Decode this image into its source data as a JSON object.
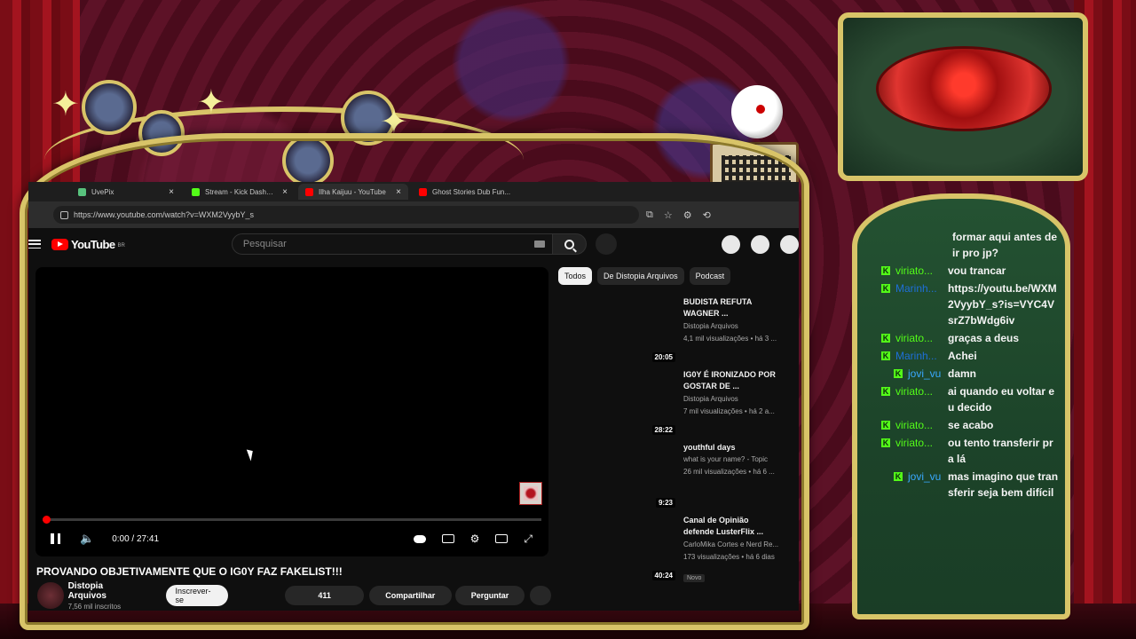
{
  "browser": {
    "tabs": [
      {
        "label": "UvePix",
        "color": "#58c27d",
        "active": false
      },
      {
        "label": "Stream - Kick Dashboard",
        "color": "#53fc18",
        "active": false
      },
      {
        "label": "Ilha Kaijuu - YouTube",
        "color": "#ff0000",
        "active": true
      },
      {
        "label": "Ghost Stories Dub Fun...",
        "color": "#ff0000",
        "active": false
      }
    ],
    "url": "https://www.youtube.com/watch?v=WXM2VyybY_s"
  },
  "youtube": {
    "logo_text": "YouTube",
    "region": "BR",
    "search_placeholder": "Pesquisar",
    "player": {
      "time": "0:00 / 27:41",
      "progress": 0.0
    },
    "video_title": "PROVANDO OBJETIVAMENTE QUE O IG0Y FAZ FAKELIST!!!",
    "channel": {
      "name": "Distopia Arquivos",
      "subscribers": "7,56 mil inscritos",
      "subscribe_label": "Inscrever-se"
    },
    "actions": {
      "likes": "411",
      "share": "Compartilhar",
      "ask": "Perguntar"
    },
    "chips": [
      "Todos",
      "De Distopia Arquivos",
      "Podcast"
    ],
    "recommendations": [
      {
        "title": "BUDISTA REFUTA WAGNER ...",
        "channel": "Distopia Arquivos",
        "meta": "4,1 mil visualizações • há 3 ...",
        "duration": "20:05",
        "new": false
      },
      {
        "title": "IG0Y É IRONIZADO POR GOSTAR DE ...",
        "channel": "Distopia Arquivos",
        "meta": "7 mil visualizações • há 2 a...",
        "duration": "28:22",
        "new": false
      },
      {
        "title": "youthful days",
        "channel": "what is your name? - Topic",
        "meta": "26 mil visualizações • há 6 ...",
        "duration": "9:23",
        "new": false
      },
      {
        "title": "Canal de Opinião defende LusterFlix ...",
        "channel": "CarloMika Cortes e Nerd Re...",
        "meta": "173 visualizações • há 6 dias",
        "duration": "40:24",
        "new": true,
        "badge": "Novo"
      }
    ]
  },
  "chat": {
    "messages": [
      {
        "user": "",
        "color": "",
        "text": "formar aqui antes de ir pro jp?",
        "kick": false,
        "indent": false
      },
      {
        "user": "viriato...",
        "color": "#53fc18",
        "text": "vou trancar",
        "kick": true,
        "indent": false
      },
      {
        "user": "Marinh...",
        "color": "#1e6fd8",
        "text": "https://youtu.be/WXM2VyybY_s?is=VYC4VsrZ7bWdg6iv",
        "kick": true,
        "indent": false
      },
      {
        "user": "viriato...",
        "color": "#53fc18",
        "text": "graças a deus",
        "kick": true,
        "indent": false
      },
      {
        "user": "Marinh...",
        "color": "#1e6fd8",
        "text": "Achei",
        "kick": true,
        "indent": false
      },
      {
        "user": "jovi_vu",
        "color": "#39a9ff",
        "text": "damn",
        "kick": true,
        "indent": true
      },
      {
        "user": "viriato...",
        "color": "#53fc18",
        "text": "ai quando eu voltar eu decido",
        "kick": true,
        "indent": false
      },
      {
        "user": "viriato...",
        "color": "#53fc18",
        "text": "se acabo",
        "kick": true,
        "indent": false
      },
      {
        "user": "viriato...",
        "color": "#53fc18",
        "text": "ou tento transferir pra lá",
        "kick": true,
        "indent": false
      },
      {
        "user": "jovi_vu",
        "color": "#39a9ff",
        "text": "mas imagino que transferir seja bem difícil",
        "kick": true,
        "indent": true
      }
    ]
  },
  "colors": {
    "gold": "#d8c468",
    "youtube_red": "#ff0000",
    "kick_green": "#53fc18",
    "yt_bg": "#0f0f0f"
  }
}
